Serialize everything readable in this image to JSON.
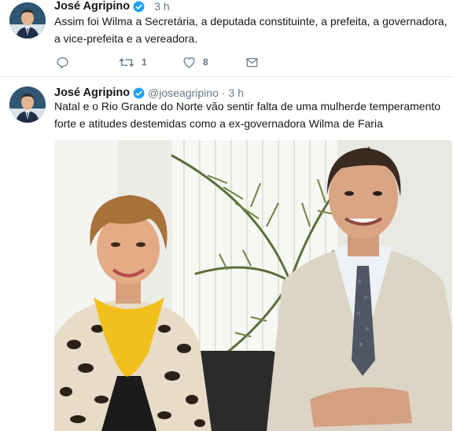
{
  "tweets": [
    {
      "author_name": "José Agripino",
      "handle": "",
      "separator": "",
      "time": "3 h",
      "text": "Assim foi Wilma a Secretária, a deputada constituinte, a prefeita, a governadora, a vice-prefeita e a vereadora.",
      "retweet_count": "1",
      "like_count": "8"
    },
    {
      "author_name": "José Agripino",
      "handle": "@joseagripino",
      "separator": "·",
      "time": "3 h",
      "text": "Natal e o Rio Grande do Norte vão sentir falta de uma mulherde temperamento forte e atitudes destemidas como a ex-governadora Wilma de Faria"
    }
  ],
  "icons": {
    "verified": "verified-badge-icon",
    "reply": "reply-icon",
    "retweet": "retweet-icon",
    "like": "heart-icon",
    "dm": "envelope-icon"
  },
  "colors": {
    "verified_blue": "#1da1f2",
    "icon_gray": "#657786",
    "divider": "#e6ecf0"
  }
}
